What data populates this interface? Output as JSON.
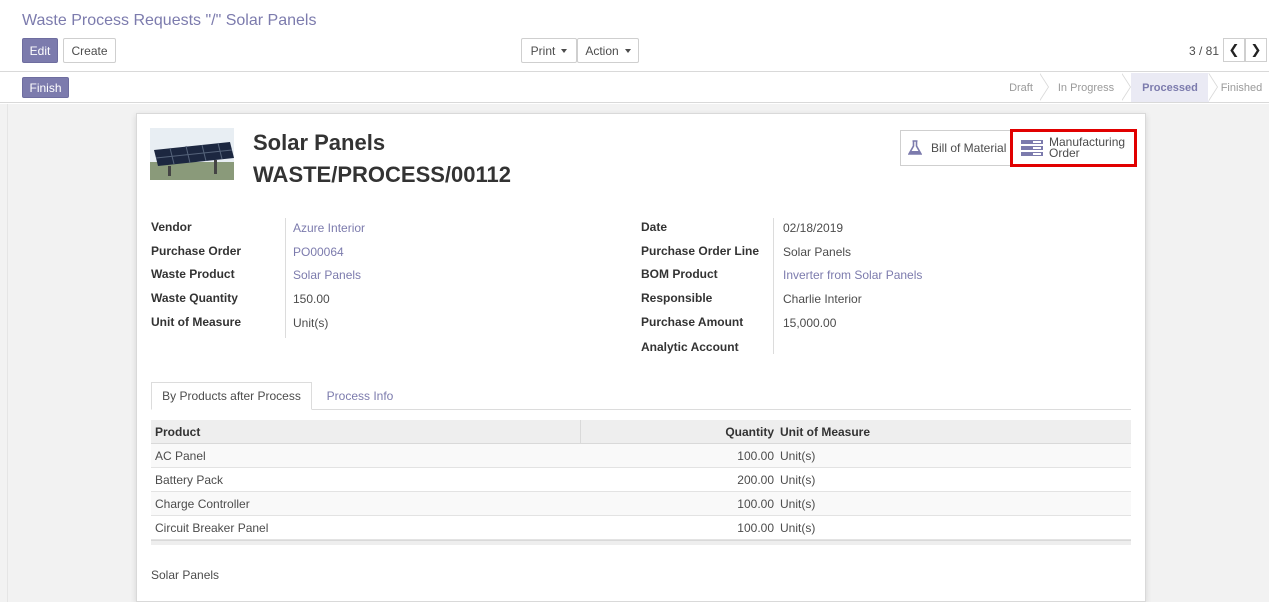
{
  "breadcrumb": "Waste Process Requests \"/\" Solar Panels",
  "toolbar": {
    "edit_label": "Edit",
    "create_label": "Create",
    "print_label": "Print",
    "action_label": "Action"
  },
  "pager": {
    "text": "3 / 81",
    "prev_icon": "chevron-left-icon",
    "next_icon": "chevron-right-icon"
  },
  "statusbar": {
    "finish_label": "Finish",
    "stages": [
      {
        "label": "Draft",
        "active": false
      },
      {
        "label": "In Progress",
        "active": false
      },
      {
        "label": "Processed",
        "active": true
      },
      {
        "label": "Finished",
        "active": false
      }
    ]
  },
  "record": {
    "name": "Solar Panels",
    "reference": "WASTE/PROCESS/00112"
  },
  "smart_buttons": {
    "bom": {
      "label": "Bill of Material",
      "icon": "flask-icon"
    },
    "mo": {
      "label_line1": "Manufacturing",
      "label_line2": "Order",
      "icon": "server-stack-icon",
      "highlight_color": "#e10000"
    }
  },
  "fields_left": [
    {
      "label": "Vendor",
      "value": "Azure Interior",
      "link": true
    },
    {
      "label": "Purchase Order",
      "value": "PO00064",
      "link": true
    },
    {
      "label": "Waste Product",
      "value": "Solar Panels",
      "link": true
    },
    {
      "label": "Waste Quantity",
      "value": "150.00",
      "link": false
    },
    {
      "label": "Unit of Measure",
      "value": "Unit(s)",
      "link": false
    }
  ],
  "fields_right": [
    {
      "label": "Date",
      "value": "02/18/2019",
      "link": false
    },
    {
      "label": "Purchase Order Line",
      "value": "Solar Panels",
      "link": false
    },
    {
      "label": "BOM Product",
      "value": "Inverter from Solar Panels",
      "link": true
    },
    {
      "label": "Responsible",
      "value": "Charlie Interior",
      "link": false
    },
    {
      "label": "Purchase Amount",
      "value": "15,000.00",
      "link": false
    },
    {
      "label": "Analytic Account",
      "value": "",
      "link": false
    }
  ],
  "tabs": [
    {
      "label": "By Products after Process",
      "active": true
    },
    {
      "label": "Process Info",
      "active": false
    }
  ],
  "table": {
    "headers": [
      "Product",
      "Quantity",
      "Unit of Measure"
    ],
    "rows": [
      [
        "AC Panel",
        "100.00",
        "Unit(s)"
      ],
      [
        "Battery Pack",
        "200.00",
        "Unit(s)"
      ],
      [
        "Charge Controller",
        "100.00",
        "Unit(s)"
      ],
      [
        "Circuit Breaker Panel",
        "100.00",
        "Unit(s)"
      ]
    ]
  },
  "note": "Solar Panels",
  "colors": {
    "accent": "#7c7bad",
    "highlight": "#e10000"
  }
}
